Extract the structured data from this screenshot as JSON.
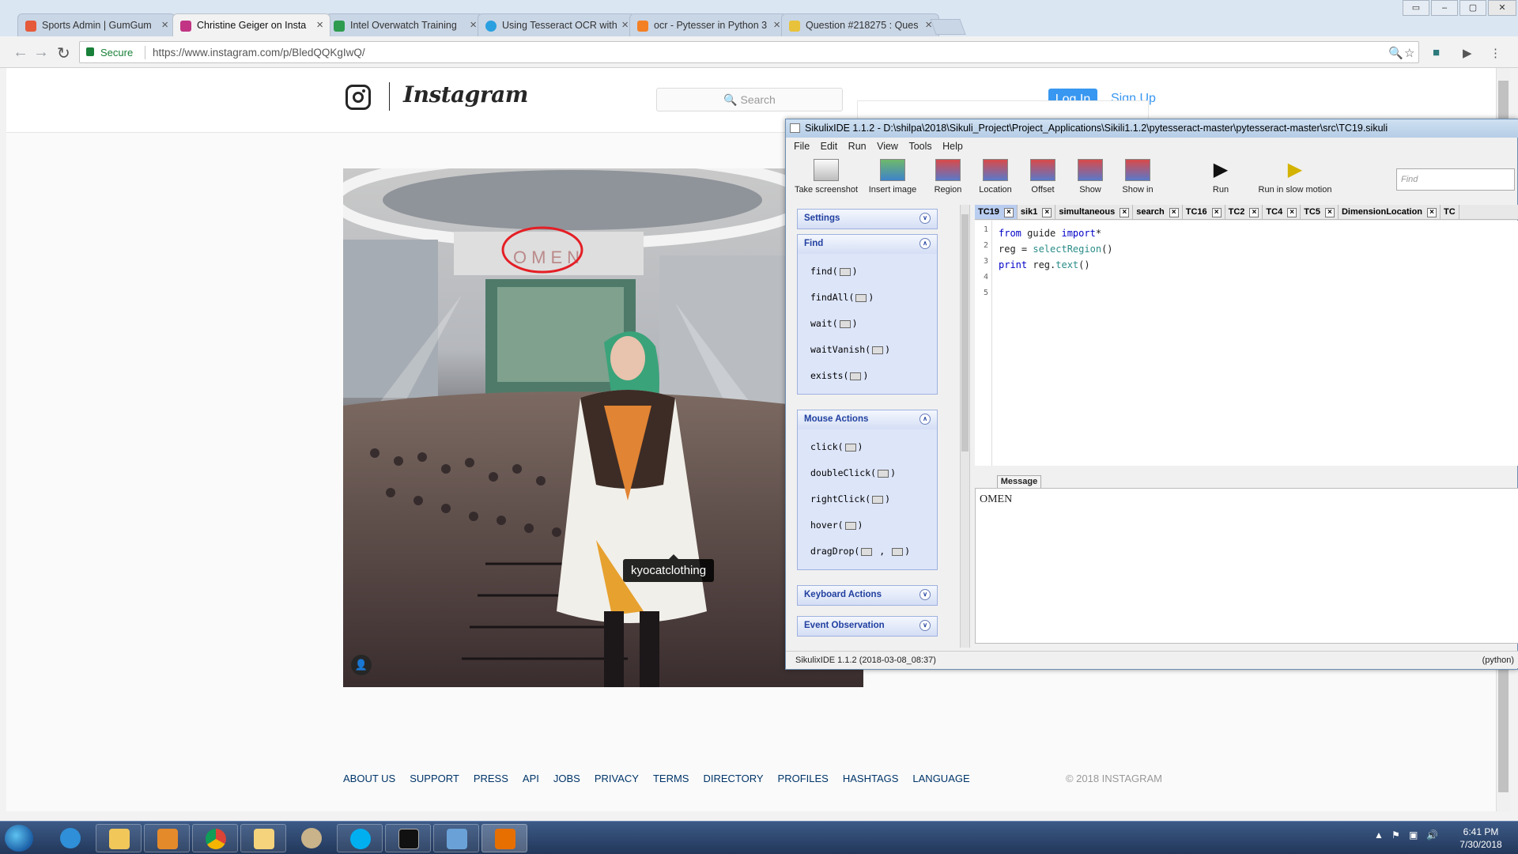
{
  "browser": {
    "tabs": [
      {
        "title": "Sports Admin | GumGum",
        "favicon_color": "#e55a3a"
      },
      {
        "title": "Christine Geiger on Insta",
        "favicon_color": "#c13584"
      },
      {
        "title": "Intel Overwatch Training",
        "favicon_color": "#2e9b4f"
      },
      {
        "title": "Using Tesseract OCR with",
        "favicon_color": "#2aa0e0"
      },
      {
        "title": "ocr - Pytesser in Python 3",
        "favicon_color": "#f48024"
      },
      {
        "title": "Question #218275 : Ques",
        "favicon_color": "#e8c23a"
      }
    ],
    "security_label": "Secure",
    "url": "https://www.instagram.com/p/BledQQKgIwQ/",
    "window_controls": [
      "▭",
      "–",
      "▢",
      "✕"
    ]
  },
  "instagram": {
    "wordmark": "Instagram",
    "search_placeholder": "🔍 Search",
    "login_label": "Log In",
    "signup_label": "Sign Up",
    "photo_tag": "kyocatclothing",
    "footer_links": [
      "ABOUT US",
      "SUPPORT",
      "PRESS",
      "API",
      "JOBS",
      "PRIVACY",
      "TERMS",
      "DIRECTORY",
      "PROFILES",
      "HASHTAGS",
      "LANGUAGE"
    ],
    "copyright": "© 2018 INSTAGRAM",
    "photo_sign_text": "OMEN"
  },
  "sikuli": {
    "title": "SikulixIDE 1.1.2 - D:\\shilpa\\2018\\Sikuli_Project\\Project_Applications\\Sikili1.1.2\\pytesseract-master\\pytesseract-master\\src\\TC19.sikuli",
    "menu": [
      "File",
      "Edit",
      "Run",
      "View",
      "Tools",
      "Help"
    ],
    "toolbar": [
      "Take screenshot",
      "Insert image",
      "Region",
      "Location",
      "Offset",
      "Show",
      "Show in",
      "Run",
      "Run in slow motion"
    ],
    "find_placeholder": "Find",
    "panels": {
      "settings": "Settings",
      "find": {
        "title": "Find",
        "commands": [
          "find(",
          "findAll(",
          "wait(",
          "waitVanish(",
          "exists("
        ]
      },
      "mouse": {
        "title": "Mouse Actions",
        "commands": [
          "click(",
          "doubleClick(",
          "rightClick(",
          "hover(",
          "dragDrop("
        ]
      },
      "keyboard": "Keyboard Actions",
      "events": "Event Observation"
    },
    "tabs": [
      "TC19",
      "sik1",
      "simultaneous",
      "search",
      "TC16",
      "TC2",
      "TC4",
      "TC5",
      "DimensionLocation",
      "TC"
    ],
    "line_numbers": [
      "1",
      "2",
      "3",
      "4",
      "5"
    ],
    "code": {
      "l1_kw1": "from",
      "l1_mid": " guide ",
      "l1_kw2": "import",
      "l1_end": "*",
      "l2_start": "reg = ",
      "l2_fn": "selectRegion",
      "l2_end": "()",
      "l3_kw": "print",
      "l3_mid": " reg.",
      "l3_fn": "text",
      "l3_end": "()"
    },
    "message_tab": "Message",
    "message_output": "OMEN",
    "status_left": "SikulixIDE 1.1.2 (2018-03-08_08:37)",
    "status_right": "(python)"
  },
  "taskbar": {
    "clock_time": "6:41 PM",
    "clock_date": "7/30/2018"
  }
}
